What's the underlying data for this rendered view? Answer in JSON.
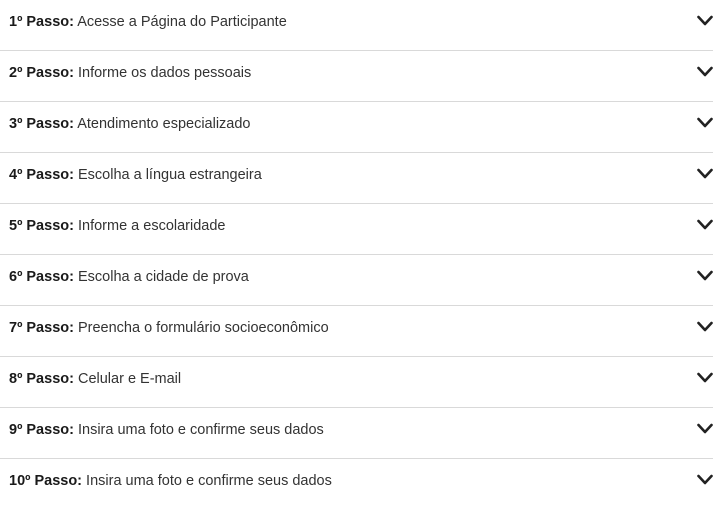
{
  "accordion": {
    "items": [
      {
        "step": "1º Passo:",
        "text": "Acesse a Página do Participante",
        "icon": "chevron-down-icon"
      },
      {
        "step": "2º Passo:",
        "text": "Informe os dados pessoais",
        "icon": "chevron-down-icon"
      },
      {
        "step": "3º Passo:",
        "text": "Atendimento especializado",
        "icon": "chevron-down-icon"
      },
      {
        "step": "4º Passo:",
        "text": "Escolha a língua estrangeira",
        "icon": "chevron-down-icon"
      },
      {
        "step": "5º Passo:",
        "text": "Informe a escolaridade",
        "icon": "chevron-down-icon"
      },
      {
        "step": "6º Passo:",
        "text": "Escolha a cidade de prova",
        "icon": "chevron-down-icon"
      },
      {
        "step": "7º Passo:",
        "text": "Preencha o formulário socioeconômico",
        "icon": "chevron-down-icon"
      },
      {
        "step": "8º Passo:",
        "text": "Celular e E-mail",
        "icon": "chevron-down-icon"
      },
      {
        "step": "9º Passo:",
        "text": "Insira uma foto e confirme seus dados",
        "icon": "chevron-down-icon"
      },
      {
        "step": "10º Passo:",
        "text": "Insira uma foto e confirme seus dados",
        "icon": "chevron-down-icon"
      }
    ]
  },
  "colors": {
    "text": "#333333",
    "step": "#1a1a1a",
    "divider": "#d9d9d9",
    "chevron": "#222222"
  }
}
